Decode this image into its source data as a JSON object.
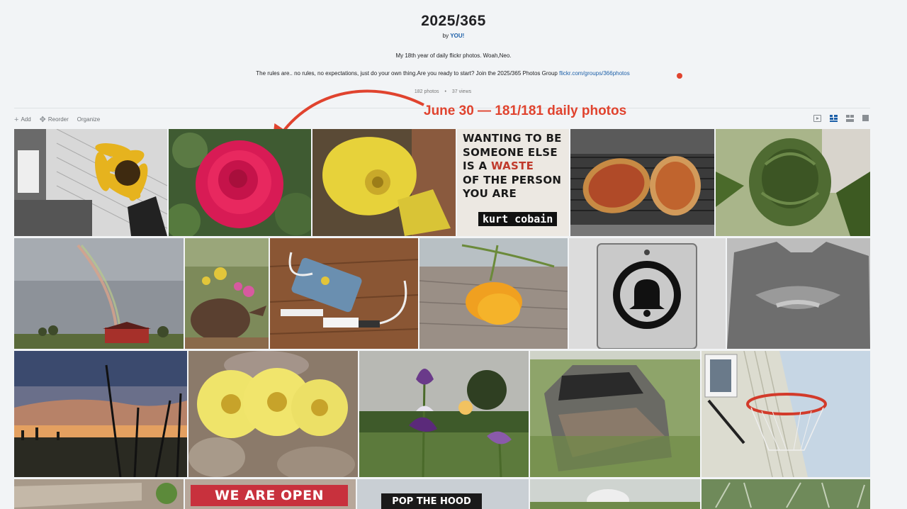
{
  "album": {
    "title": "2025/365",
    "by_prefix": "by",
    "author": "YOU!",
    "description_line1": "My 18th year of daily flickr photos. Woah,Neo.",
    "description_line2": "The rules are.. no rules, no expectations, just do your own thing.Are you ready to start? Join the 2025/365 Photos Group",
    "group_link": "flickr.com/groups/366photos",
    "photo_count": "182 photos",
    "views": "37 views"
  },
  "toolbar": {
    "add_label": "Add",
    "reorder_label": "Reorder",
    "organize_label": "Organize"
  },
  "view_modes": [
    "slideshow-icon",
    "grid-icon",
    "mosaic-icon",
    "single-icon"
  ],
  "annotation": {
    "text": "June 30 — 181/181 daily photos",
    "color": "#e0432e"
  },
  "photos_row1": [
    {
      "subject": "sunflower"
    },
    {
      "subject": "red rose"
    },
    {
      "subject": "yellow cactus flower"
    },
    {
      "subject": "sign",
      "sign_lines": [
        "WANTING TO BE",
        "SOMEONE ELSE",
        "IS A ",
        "WASTE",
        "OF THE PERSON",
        "YOU ARE"
      ],
      "sign_caption": "kurt cobain"
    },
    {
      "subject": "pizza on grill"
    },
    {
      "subject": "green bud"
    }
  ],
  "photos_row4": [
    {
      "subject": "wood"
    },
    {
      "subject": "banner",
      "banner_text": "WE ARE OPEN"
    },
    {
      "subject": "sign",
      "sign_text": "POP THE HOOD"
    },
    {
      "subject": "plant"
    },
    {
      "subject": "silver foliage"
    }
  ],
  "colors": {
    "accent": "#1c5fa8",
    "annotation_red": "#e0432e",
    "background": "#f2f4f6"
  }
}
